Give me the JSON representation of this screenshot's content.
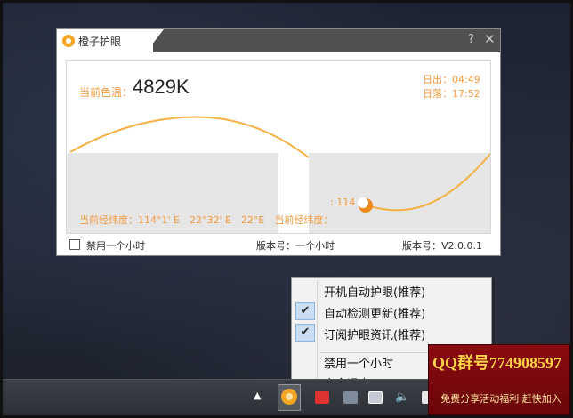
{
  "app": {
    "title": "橙子护眼",
    "help_icon": "?",
    "close_icon": "✕",
    "current_temp_label": "当前色温：",
    "current_temp_value": "4829K",
    "sunrise": "日出：04:49",
    "sunset": "日落：17:52",
    "coordinates": "当前经纬度：114°1' E　22°32' E　22°E　当前经纬度：",
    "marker_label": ": 114",
    "footer": {
      "disable_label": "禁用一个小时",
      "version_mid": "版本号：一个小时",
      "version": "版本号：V2.0.0.1"
    },
    "colors": {
      "accent": "#f29a3c",
      "curve": "#f5b042",
      "night_fill": "#e6e6e6"
    }
  },
  "menu": {
    "items": [
      {
        "label": "开机自动护眼(推荐)",
        "checked": false
      },
      {
        "label": "自动检测更新(推荐)",
        "checked": true
      },
      {
        "label": "订阅护眼资讯(推荐)",
        "checked": true
      },
      {
        "label": "禁用一个小时",
        "checked": false
      },
      {
        "label": "完全退出",
        "checked": false
      }
    ],
    "check_glyph": "✔"
  },
  "taskbar": {
    "tray_arrow": "▲",
    "speaker_glyph": "🔈"
  },
  "ad": {
    "title": "QQ群号774908597",
    "subtitle": "免费分享活动福利 赶快加入"
  }
}
